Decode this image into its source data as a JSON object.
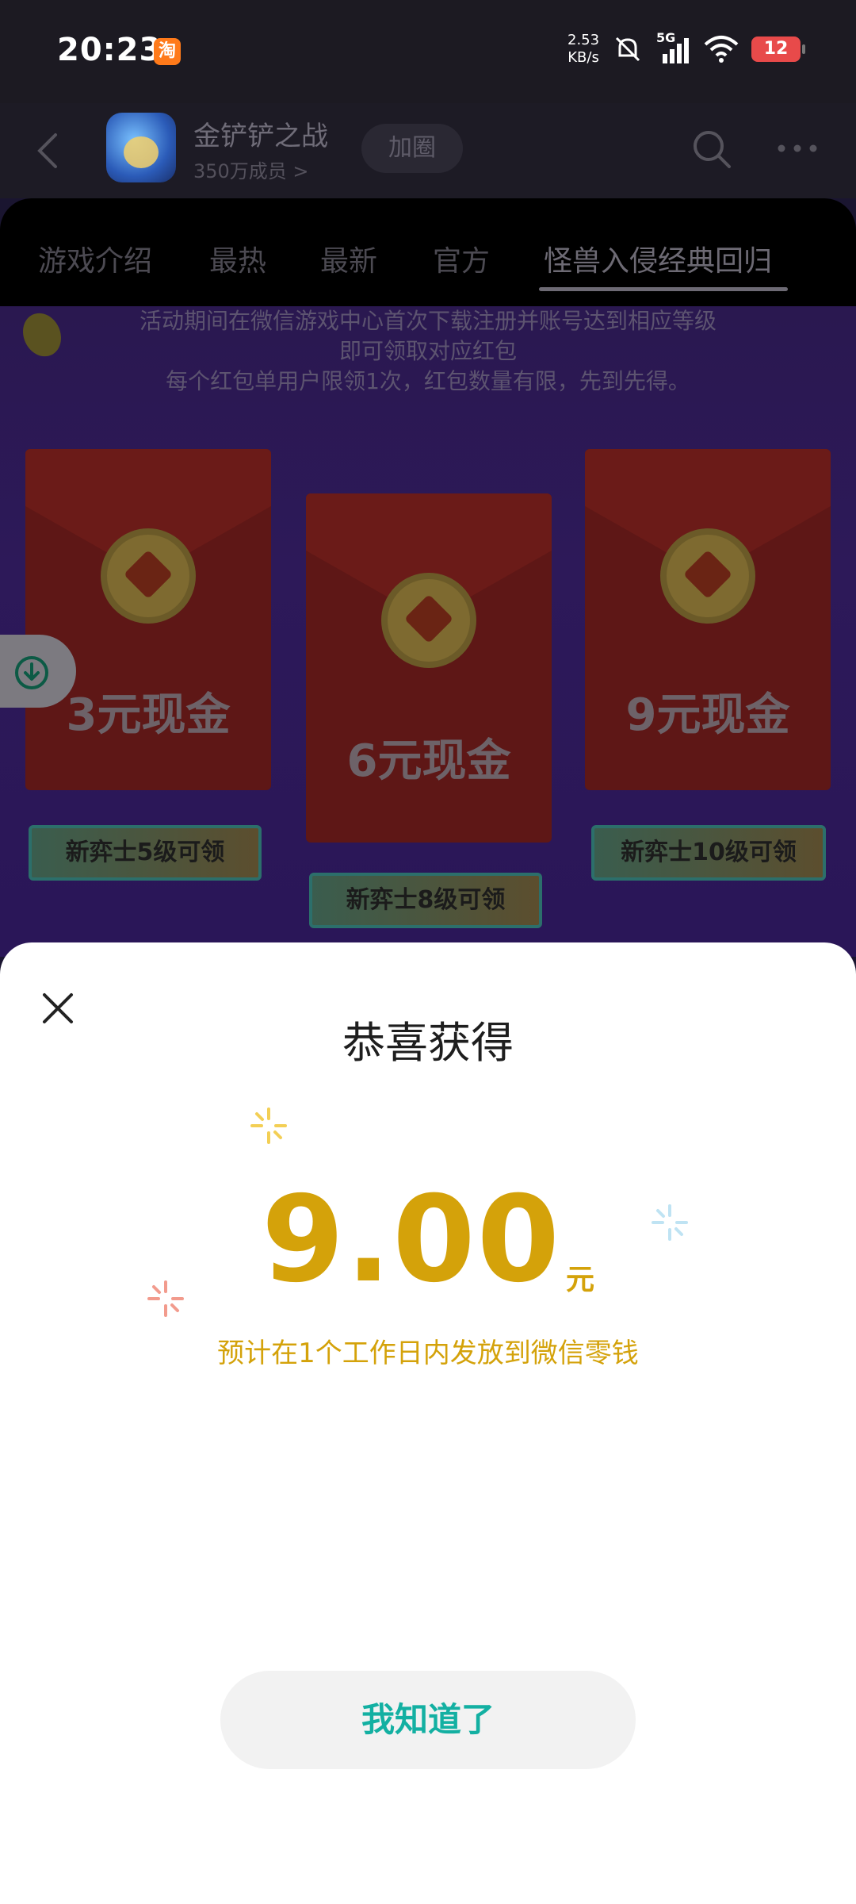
{
  "status_bar": {
    "time": "20:23",
    "taobao_glyph": "淘",
    "net_speed_value": "2.53",
    "net_speed_unit": "KB/s",
    "network": "5G",
    "battery": "12"
  },
  "header": {
    "game_name": "金铲铲之战",
    "member_count": "350万成员 >",
    "join_label": "加圈"
  },
  "tabs": [
    {
      "label": "游戏介绍"
    },
    {
      "label": "最热"
    },
    {
      "label": "最新"
    },
    {
      "label": "官方"
    },
    {
      "label": "怪兽入侵经典回归",
      "active": true
    }
  ],
  "promo": {
    "line1": "活动期间在微信游戏中心首次下载注册并账号达到相应等级",
    "line2": "即可领取对应红包",
    "line3": "每个红包单用户限领1次，红包数量有限，先到先得。",
    "envelopes": [
      {
        "amount": "3元现金",
        "badge": "新弈士5级可领"
      },
      {
        "amount": "6元现金",
        "badge": "新弈士8级可领"
      },
      {
        "amount": "9元现金",
        "badge": "新弈士10级可领"
      }
    ]
  },
  "sheet": {
    "title": "恭喜获得",
    "amount": "9.00",
    "unit": "元",
    "note": "预计在1个工作日内发放到微信零钱",
    "ok_label": "我知道了"
  },
  "colors": {
    "accent_gold": "#d4a20a",
    "accent_teal": "#13b0a2"
  }
}
